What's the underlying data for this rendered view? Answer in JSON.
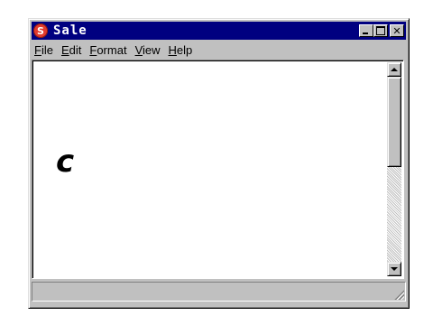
{
  "window": {
    "title": "Sale",
    "app_icon_letter": "S",
    "app_icon_color": "#e23b2e",
    "titlebar_color": "#000080"
  },
  "menu": {
    "items": [
      {
        "underline": "F",
        "rest": "ile"
      },
      {
        "underline": "E",
        "rest": "dit"
      },
      {
        "underline": "F",
        "rest": "ormat"
      },
      {
        "underline": "V",
        "rest": "iew"
      },
      {
        "underline": "H",
        "rest": "elp"
      }
    ]
  },
  "document": {
    "text": "c"
  },
  "icons": {
    "minimize": "minimize-icon",
    "maximize": "maximize-icon",
    "close": "close-icon",
    "scroll_up": "arrow-up-icon",
    "scroll_down": "arrow-down-icon",
    "resize": "resize-grip-icon"
  },
  "scrollbar": {
    "position_fraction": 0.0
  },
  "close_glyph": "✕"
}
